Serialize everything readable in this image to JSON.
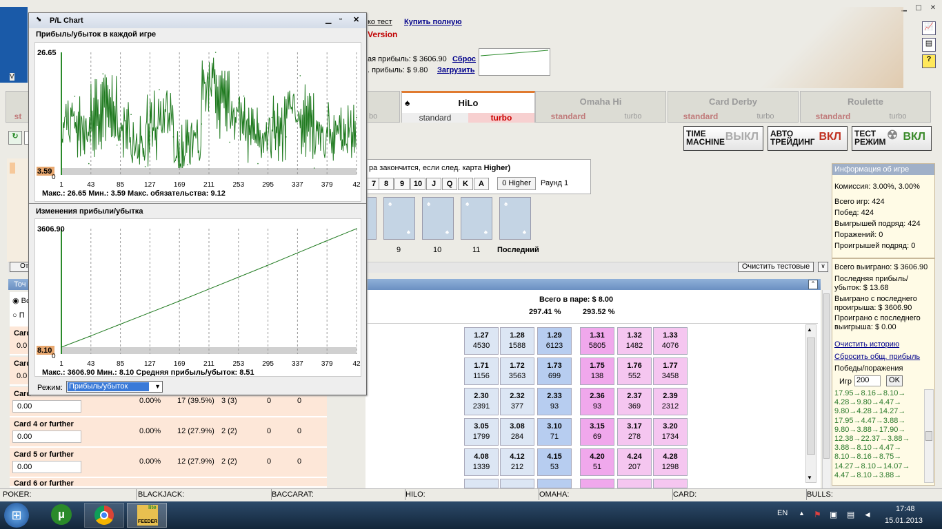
{
  "app": {
    "version_prefix": "V",
    "top_link_partial": "ко тест",
    "buy_link": "Купить полную",
    "version_label": "Version",
    "total_profit": "ая прибыль: $ 3606.90",
    "reset_link": "Сброс",
    "profit2": ". прибыль: $ 9.80",
    "load_link": "Загрузить"
  },
  "tabs": [
    {
      "title": "",
      "s1": "st",
      "s2": ""
    },
    {
      "title": "HiLo",
      "s1": "standard",
      "s2": "turbo"
    },
    {
      "title": "Omaha Hi",
      "s1": "standard",
      "s2": "turbo"
    },
    {
      "title": "Card Derby",
      "s1": "standard",
      "s2": "turbo"
    },
    {
      "title": "Roulette",
      "s1": "standard",
      "s2": "turbo"
    }
  ],
  "buttons": {
    "time_machine": "TIME MACHINE",
    "time_machine_state": "ВЫКЛ",
    "auto": "АВТО ТРЕЙДИНГ",
    "auto_state": "ВКЛ",
    "test": "ТЕСТ РЕЖИМ",
    "test_state": "ВКЛ",
    "clear_test": "Очистить тестовые"
  },
  "game": {
    "rule": "ра закончится, если след. карта",
    "rule_bold": "Higher)",
    "cards": [
      "7",
      "8",
      "9",
      "10",
      "J",
      "Q",
      "K",
      "A"
    ],
    "higher_btn": "0 Higher",
    "round": "Раунд 1",
    "positions": [
      "9",
      "10",
      "11",
      "Последний"
    ]
  },
  "pair": {
    "total": "Всего в паре: $ 8.00",
    "pct1": "297.41 %",
    "pct2": "293.52 %"
  },
  "left": {
    "rows": [
      {
        "name": "Card",
        "val": "0.0"
      },
      {
        "name": "Card",
        "val": "0.0"
      },
      {
        "name": "Card",
        "val": "0.00",
        "pct": "0.00%",
        "n": "17 (39.5%)",
        "s": "3 (3)",
        "z1": "0",
        "z2": "0"
      },
      {
        "name": "Card 4 or further",
        "val": "0.00",
        "pct": "0.00%",
        "n": "12 (27.9%)",
        "s": "2 (2)",
        "z1": "0",
        "z2": "0"
      },
      {
        "name": "Card 5 or further",
        "val": "0.00",
        "pct": "0.00%",
        "n": "12 (27.9%)",
        "s": "2 (2)",
        "z1": "0",
        "z2": "0"
      },
      {
        "name": "Card 6 or further",
        "val": "",
        "pct": "",
        "n": "",
        "s": "",
        "z1": "",
        "z2": ""
      }
    ],
    "tab_label": "Точ",
    "radio1": "Вс",
    "radio2": "П",
    "btn_ot": "От"
  },
  "odds": [
    [
      {
        "o": "1.27",
        "n": "4530"
      },
      {
        "o": "1.28",
        "n": "1588"
      },
      {
        "o": "1.29",
        "n": "6123"
      },
      {
        "o": "1.31",
        "n": "5805"
      },
      {
        "o": "1.32",
        "n": "1482"
      },
      {
        "o": "1.33",
        "n": "4076"
      }
    ],
    [
      {
        "o": "1.71",
        "n": "1156"
      },
      {
        "o": "1.72",
        "n": "3563"
      },
      {
        "o": "1.73",
        "n": "699"
      },
      {
        "o": "1.75",
        "n": "138"
      },
      {
        "o": "1.76",
        "n": "552"
      },
      {
        "o": "1.77",
        "n": "3458"
      }
    ],
    [
      {
        "o": "2.30",
        "n": "2391"
      },
      {
        "o": "2.32",
        "n": "377"
      },
      {
        "o": "2.33",
        "n": "93"
      },
      {
        "o": "2.36",
        "n": "93"
      },
      {
        "o": "2.37",
        "n": "369"
      },
      {
        "o": "2.39",
        "n": "2312"
      }
    ],
    [
      {
        "o": "3.05",
        "n": "1799"
      },
      {
        "o": "3.08",
        "n": "284"
      },
      {
        "o": "3.10",
        "n": "71"
      },
      {
        "o": "3.15",
        "n": "69"
      },
      {
        "o": "3.17",
        "n": "278"
      },
      {
        "o": "3.20",
        "n": "1734"
      }
    ],
    [
      {
        "o": "4.08",
        "n": "1339"
      },
      {
        "o": "4.12",
        "n": "212"
      },
      {
        "o": "4.15",
        "n": "53"
      },
      {
        "o": "4.20",
        "n": "51"
      },
      {
        "o": "4.24",
        "n": "207"
      },
      {
        "o": "4.28",
        "n": "1298"
      }
    ]
  ],
  "info": {
    "header": "Информация об игре",
    "commission": "Комиссия: 3.00%, 3.00%",
    "total_games": "Всего игр: 424",
    "wins": "Побед: 424",
    "win_streak": "Выигрышей подряд: 424",
    "losses": "Поражений: 0",
    "loss_streak": "Проигрышей подряд: 0",
    "total_won": "Всего выиграно: $ 3606.90",
    "last_pl": "Последняя прибыль/убыток: $ 13.68",
    "won_since_loss": "Выиграно с последнего проигрыша: $ 3606.90",
    "lost_since_win": "Проиграно с последнего выигрыша: $ 0.00",
    "clear_history": "Очистить историю",
    "reset_profit": "Сбросить общ. прибыль",
    "wl": "Победы/поражения",
    "games_label": "Игр",
    "games_value": "200",
    "ok": "OK",
    "history": [
      "17.95→8.16→8.10→",
      "4.28→9.80→4.47→",
      "9.80→4.28→14.27→",
      "17.95→4.47→3.88→",
      "9.80→3.88→17.90→",
      "12.38→22.37→3.88→",
      "3.88→8.10→4.47→",
      "8.10→8.16→8.75→",
      "14.27→8.10→14.07→",
      "4.47→8.10→3.88→"
    ]
  },
  "pl_window": {
    "title": "P/L Chart",
    "chart1_title": "Прибыль/убыток в каждой игре",
    "chart2_title": "Изменения прибыли/убытка",
    "stats1": "Макс.: 26.65   Мин.: 3.59   Макс. обязательства: 9.12",
    "stats2": "Макс.: 3606.90   Мин.: 8.10   Средняя прибыль/убыток: 8.51",
    "mode_label": "Режим:",
    "mode_value": "Прибыль/убыток"
  },
  "chart_data": [
    {
      "type": "line",
      "title": "Прибыль/убыток в каждой игре",
      "ylim": [
        3.59,
        26.65
      ],
      "ymax_label": "26.65",
      "ymin_label": "3.59",
      "zero_label": "0",
      "xticks": [
        "1",
        "43",
        "85",
        "127",
        "169",
        "211",
        "253",
        "295",
        "337",
        "379",
        "42"
      ],
      "x": [
        1,
        20,
        40,
        60,
        80,
        100,
        120,
        140,
        160,
        180,
        200,
        220,
        240,
        260,
        280,
        300,
        320,
        340,
        360,
        380,
        400,
        420
      ],
      "y": [
        8.1,
        17.9,
        4.47,
        22.37,
        8.16,
        14.27,
        3.88,
        19.2,
        9.8,
        4.28,
        12.38,
        26.65,
        8.75,
        17.95,
        4.47,
        13.68,
        9.8,
        22.0,
        3.59,
        14.07,
        8.1,
        13.68
      ]
    },
    {
      "type": "line",
      "title": "Изменения прибыли/убытка",
      "ylim": [
        8.1,
        3606.9
      ],
      "ymax_label": "3606.90",
      "ymin_label": "8.10",
      "zero_label": "0",
      "xticks": [
        "1",
        "43",
        "85",
        "127",
        "169",
        "211",
        "253",
        "295",
        "337",
        "379",
        "42"
      ],
      "x": [
        1,
        43,
        85,
        127,
        169,
        211,
        253,
        295,
        337,
        379,
        424
      ],
      "y": [
        8.1,
        350,
        700,
        1050,
        1400,
        1760,
        2120,
        2480,
        2850,
        3220,
        3606.9
      ]
    }
  ],
  "taskbar": {
    "poker": "POKER:",
    "blackjack": "BLACKJACK:",
    "baccarat": "BACCARAT:",
    "hilo": "HILO:",
    "omaha": "OMAHA:",
    "card": "CARD:",
    "bulls": "BULLS:",
    "lang": "EN",
    "time": "17:48",
    "date": "15.01.2013",
    "feeder": "FEEDER",
    "lite": "lite"
  }
}
